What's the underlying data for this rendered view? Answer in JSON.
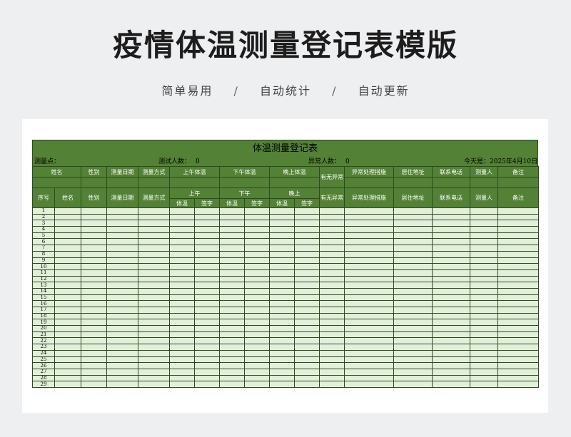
{
  "header": {
    "title": "疫情体温测量登记表模版",
    "features": [
      "简单易用",
      "自动统计",
      "自动更新"
    ],
    "separator": "/"
  },
  "sheet": {
    "banner_title": "体温测量登记表",
    "info": {
      "location_label": "测量点：",
      "tested_count_label": "测试人数：",
      "tested_count": "0",
      "abnormal_count_label": "异常人数：",
      "abnormal_count": "0",
      "today_label": "今天是：",
      "today_value": "2025年4月10日"
    },
    "header_row1": {
      "name": "姓名",
      "gender": "性别",
      "date": "测量日期",
      "method": "测量方式",
      "morning": "上午体温",
      "afternoon": "下午体温",
      "evening": "晚上体温",
      "abnormal": "有无异常",
      "measures": "异常处理措施",
      "address": "居住地址",
      "phone": "联系电话",
      "measurer": "测量人",
      "remarks": "备注"
    },
    "header_row2": {
      "seq": "序号",
      "name": "姓名",
      "gender": "性别",
      "date": "测量日期",
      "method": "测量方式",
      "morning": "上午",
      "afternoon": "下午",
      "evening": "晚上",
      "abnormal": "有无异常",
      "measures": "异常处理措施",
      "address": "居住地址",
      "phone": "联系电话",
      "measurer": "测量人",
      "remarks": "备注",
      "temp": "体温",
      "sign": "签字"
    },
    "row_numbers": [
      "1",
      "2",
      "3",
      "4",
      "5",
      "6",
      "7",
      "8",
      "9",
      "10",
      "11",
      "12",
      "13",
      "14",
      "15",
      "16",
      "17",
      "18",
      "19",
      "20",
      "21",
      "22",
      "23",
      "24",
      "25",
      "26",
      "27",
      "28",
      "29"
    ]
  },
  "colors": {
    "background": "#eeeff1",
    "header_green": "#538135",
    "body_green": "#e2efda",
    "border": "#2f4a1f"
  }
}
